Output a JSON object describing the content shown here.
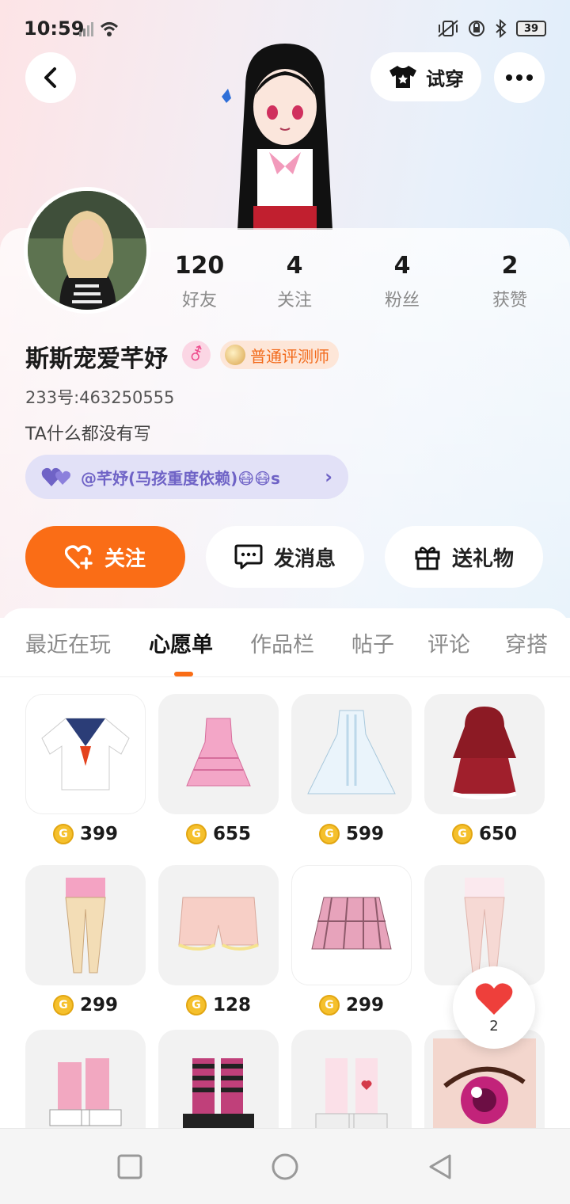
{
  "status_bar": {
    "time": "10:59",
    "battery": "39"
  },
  "header": {
    "tryon_label": "试穿"
  },
  "profile": {
    "name": "斯斯宠爱芊妤",
    "gender_symbol": "⚦",
    "badge": "普通评测师",
    "uid": "233号:463250555",
    "bio": "TA什么都没有写",
    "relation": "@芊妤(马孩重度依赖)😷😷s"
  },
  "stats": [
    {
      "value": "120",
      "label": "好友"
    },
    {
      "value": "4",
      "label": "关注"
    },
    {
      "value": "4",
      "label": "粉丝"
    },
    {
      "value": "2",
      "label": "获赞"
    }
  ],
  "actions": {
    "follow": "关注",
    "message": "发消息",
    "gift": "送礼物"
  },
  "tabs": [
    "最近在玩",
    "心愿单",
    "作品栏",
    "帖子",
    "评论",
    "穿搭"
  ],
  "active_tab": "心愿单",
  "wishlist": [
    {
      "name": "sailor-shirt",
      "price": "399"
    },
    {
      "name": "pink-plaid-dress",
      "price": "655"
    },
    {
      "name": "white-gown",
      "price": "599"
    },
    {
      "name": "red-hood-dress",
      "price": "650"
    },
    {
      "name": "pink-tights",
      "price": "299"
    },
    {
      "name": "bloomers",
      "price": "128"
    },
    {
      "name": "plaid-skirt",
      "price": "299"
    },
    {
      "name": "white-tights",
      "price": ""
    },
    {
      "name": "pink-boots",
      "price": ""
    },
    {
      "name": "striped-boots",
      "price": ""
    },
    {
      "name": "heart-socks",
      "price": ""
    },
    {
      "name": "pink-eye",
      "price": ""
    }
  ],
  "like_count": "2",
  "coin_symbol": "G",
  "colors": {
    "accent": "#fa6d16",
    "relation": "#6f63c6"
  }
}
